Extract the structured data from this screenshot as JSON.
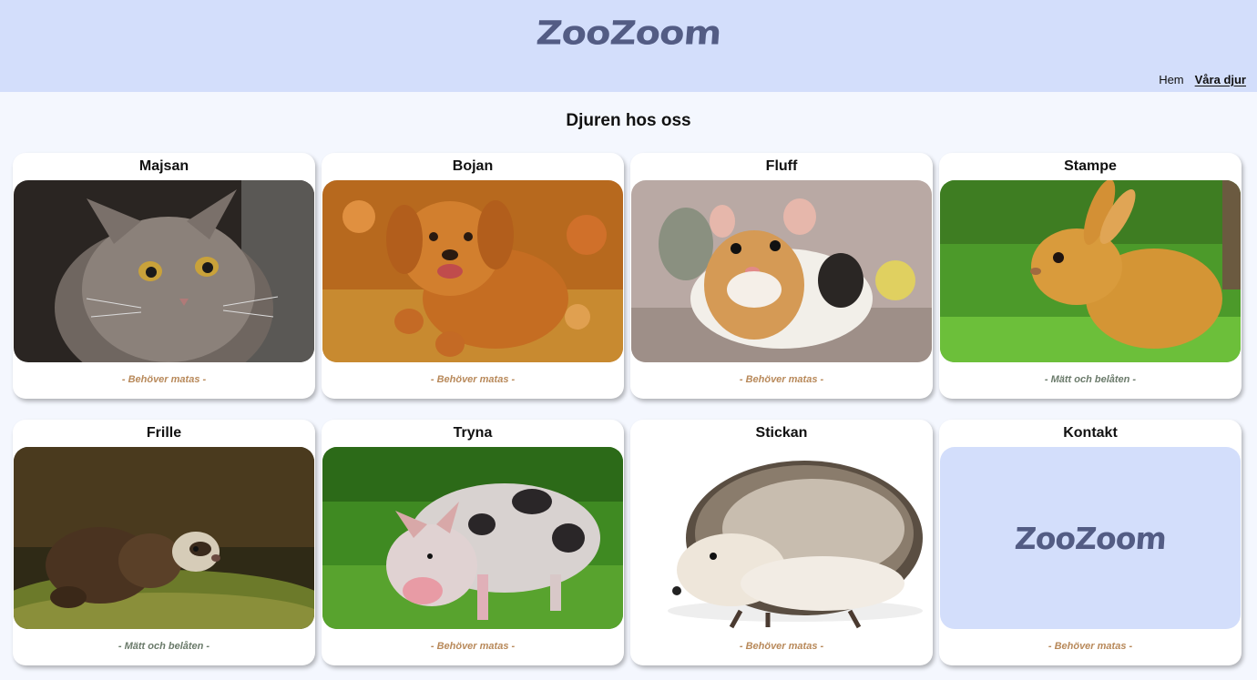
{
  "header": {
    "logo_text": "ZooZoom",
    "nav": {
      "home": "Hem",
      "animals": "Våra djur"
    }
  },
  "main": {
    "title": "Djuren hos oss",
    "cards": [
      {
        "name": "Majsan",
        "status": "- Behöver matas -",
        "photo": "cat-photo"
      },
      {
        "name": "Bojan",
        "status": "- Behöver matas -",
        "photo": "dog-photo"
      },
      {
        "name": "Fluff",
        "status": "- Behöver matas -",
        "photo": "hamster-photo"
      },
      {
        "name": "Stampe",
        "status": "- Mätt och belåten -",
        "photo": "rabbit-photo"
      },
      {
        "name": "Frille",
        "status": "- Mätt och belåten -",
        "photo": "ferret-photo"
      },
      {
        "name": "Tryna",
        "status": "- Behöver matas -",
        "photo": "pig-photo"
      },
      {
        "name": "Stickan",
        "status": "- Behöver matas -",
        "photo": "hedgehog-photo"
      },
      {
        "name": "Kontakt",
        "status": "- Behöver matas -",
        "logo_text": "ZooZoom"
      }
    ]
  },
  "colors": {
    "header_bg": "#d3defb",
    "page_bg": "#f4f7fe",
    "logo": "#535c84",
    "status_hungry": "#b8895a",
    "status_full": "#6a7a6a"
  }
}
